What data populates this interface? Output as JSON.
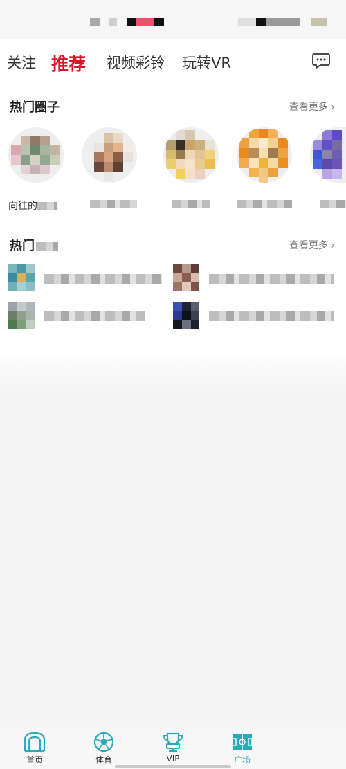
{
  "tabs": [
    {
      "label": "关注"
    },
    {
      "label": "推荐"
    },
    {
      "label": "视频彩铃"
    },
    {
      "label": "玩转VR"
    }
  ],
  "active_tab": "推荐",
  "hot_circles": {
    "title": "热门圈子",
    "more": "查看更多 ›",
    "items": [
      {
        "name": "向往的"
      },
      {
        "name": ""
      },
      {
        "name": ""
      },
      {
        "name": ""
      },
      {
        "name": ""
      }
    ]
  },
  "hot_songs": {
    "title": "热门",
    "more": "查看更多 ›"
  },
  "bottom_nav": [
    {
      "label": "首页"
    },
    {
      "label": "体育"
    },
    {
      "label": "VIP"
    },
    {
      "label": "广场"
    }
  ],
  "active_nav": "广场",
  "colors": {
    "accent_red": "#d9142b",
    "accent_teal": "#2aa9b6"
  }
}
